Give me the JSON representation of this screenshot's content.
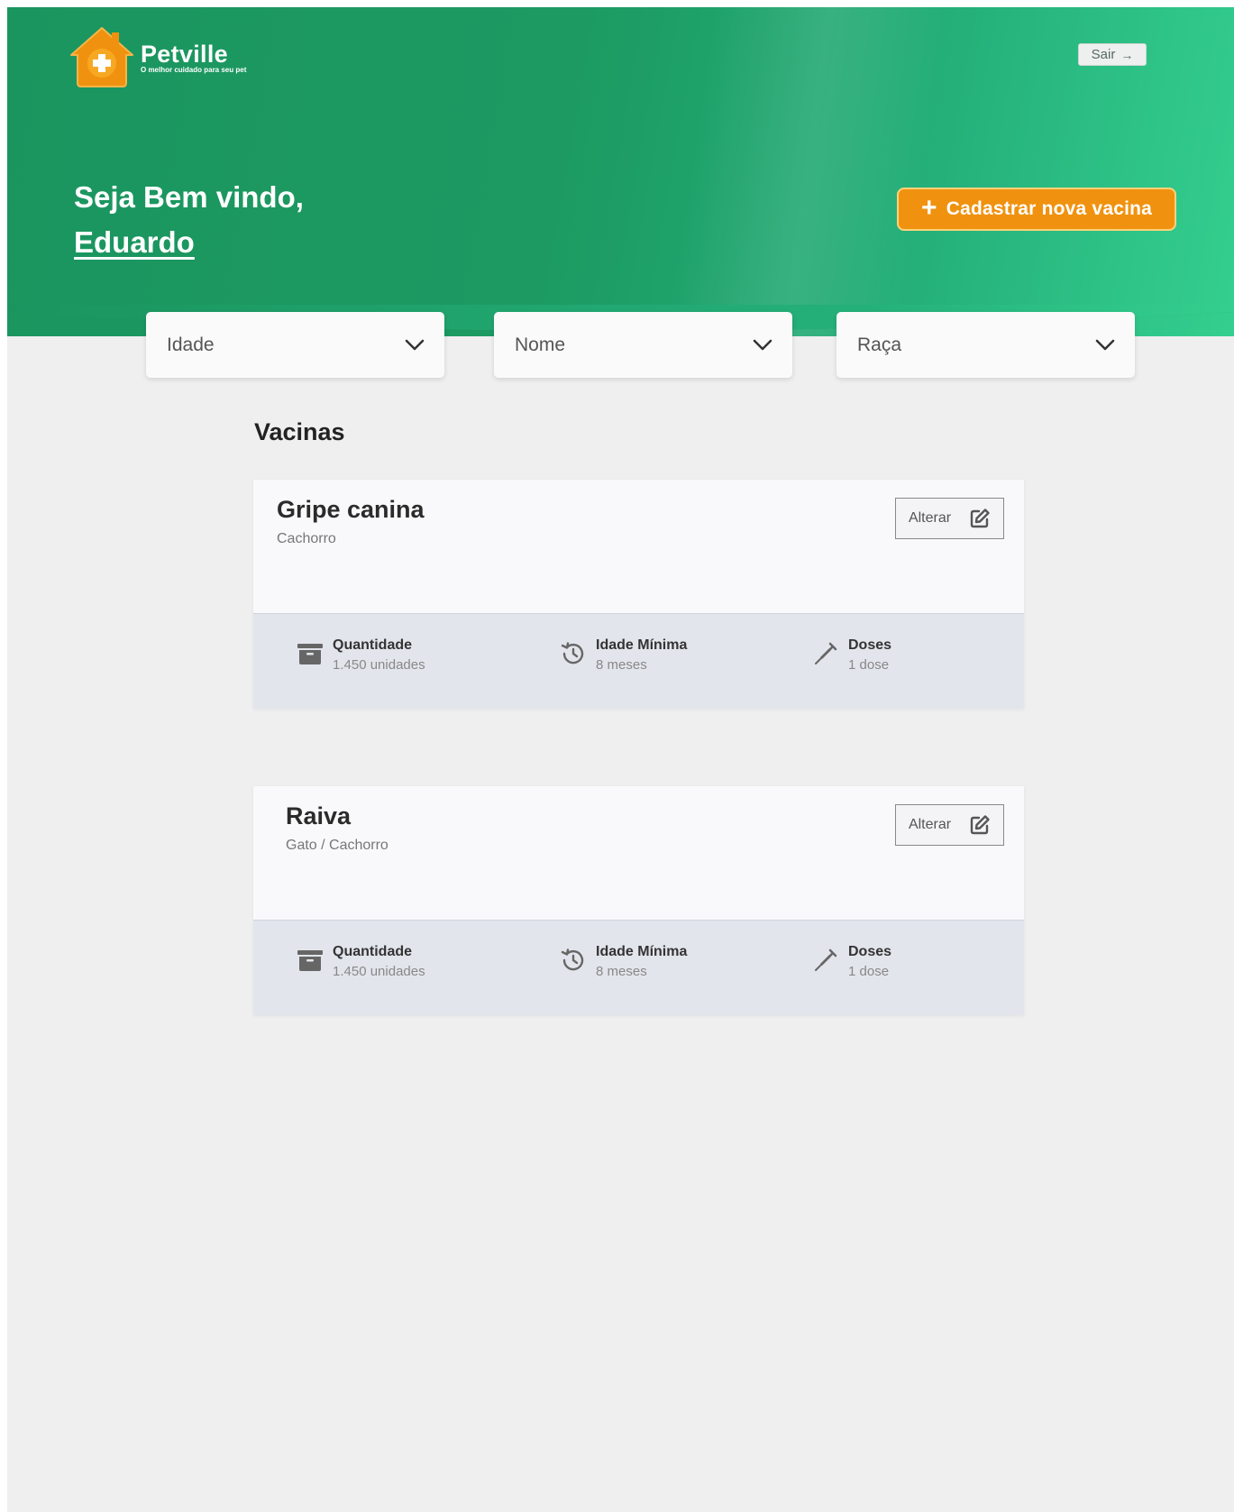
{
  "brand": {
    "name": "Petville",
    "tagline": "O melhor cuidado para seu pet",
    "primary_color": "#1c9a62",
    "accent_color": "#f0920f"
  },
  "header": {
    "logout_label": "Sair",
    "logout_icon": "arrow-right-icon",
    "welcome_line": "Seja Bem vindo,",
    "user_name": "Eduardo",
    "new_vaccine_label": "Cadastrar nova vacina"
  },
  "filters": [
    {
      "label": "Idade"
    },
    {
      "label": "Nome"
    },
    {
      "label": "Raça"
    }
  ],
  "section": {
    "title": "Vacinas"
  },
  "vaccines": [
    {
      "name": "Gripe canina",
      "species": "Cachorro",
      "edit_label": "Alterar",
      "quantity_label": "Quantidade",
      "quantity_value": "1.450 unidades",
      "min_age_label": "Idade Mínima",
      "min_age_value": "8 meses",
      "doses_label": "Doses",
      "doses_value": "1 dose"
    },
    {
      "name": "Raiva",
      "species": "Gato / Cachorro",
      "edit_label": "Alterar",
      "quantity_label": "Quantidade",
      "quantity_value": "1.450 unidades",
      "min_age_label": "Idade Mínima",
      "min_age_value": "8 meses",
      "doses_label": "Doses",
      "doses_value": "1 dose"
    }
  ]
}
